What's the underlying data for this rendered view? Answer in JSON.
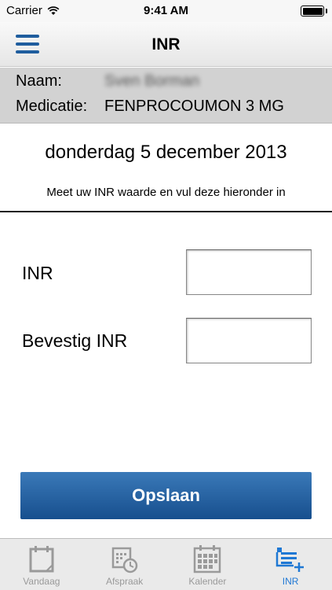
{
  "status_bar": {
    "carrier": "Carrier",
    "time": "9:41 AM"
  },
  "nav": {
    "title": "INR"
  },
  "info": {
    "name_label": "Naam:",
    "name_value": "Sven Borman",
    "medication_label": "Medicatie:",
    "medication_value": "FENPROCOUMON 3 MG"
  },
  "date": "donderdag 5 december 2013",
  "instruction": "Meet uw INR waarde en vul deze hieronder in",
  "form": {
    "inr_label": "INR",
    "inr_value": "",
    "confirm_label": "Bevestig INR",
    "confirm_value": ""
  },
  "save_label": "Opslaan",
  "tabs": [
    {
      "label": "Vandaag",
      "icon": "calendar-today-icon",
      "active": false
    },
    {
      "label": "Afspraak",
      "icon": "appointment-clock-icon",
      "active": false
    },
    {
      "label": "Kalender",
      "icon": "calendar-grid-icon",
      "active": false
    },
    {
      "label": "INR",
      "icon": "add-measurement-icon",
      "active": true
    }
  ],
  "colors": {
    "accent": "#1f5d9e",
    "button": "#1f5a9a",
    "active_tab": "#1f78d4",
    "info_panel": "#d2d2d2"
  }
}
